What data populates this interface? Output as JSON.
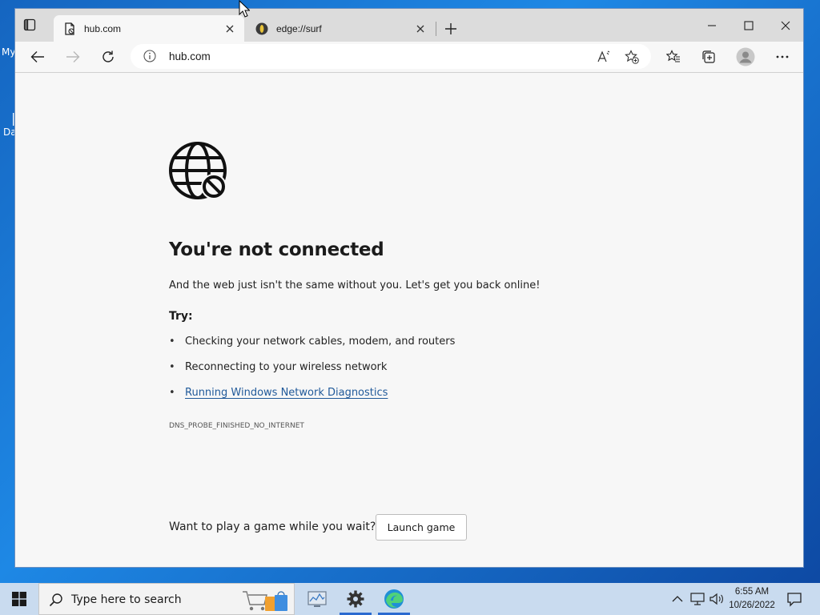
{
  "desktop": {
    "label_1": "My",
    "label_2": "Da"
  },
  "browser": {
    "tabs": [
      {
        "title": "hub.com",
        "favicon": "document-icon",
        "active": true
      },
      {
        "title": "edge://surf",
        "favicon": "surf-icon",
        "active": false
      }
    ],
    "address": "hub.com"
  },
  "error_page": {
    "icon": "globe-blocked-icon",
    "headline": "You're not connected",
    "subtitle": "And the web just isn't the same without you. Let's get you back online!",
    "try_label": "Try:",
    "suggestions": [
      "Checking your network cables, modem, and routers",
      "Reconnecting to your wireless network",
      "Running Windows Network Diagnostics"
    ],
    "error_code": "DNS_PROBE_FINISHED_NO_INTERNET",
    "game_prompt": "Want to play a game while you wait?",
    "game_button": "Launch game"
  },
  "taskbar": {
    "search_placeholder": "Type here to search",
    "time": "6:55 AM",
    "date": "10/26/2022"
  },
  "colors": {
    "link": "#215a9a",
    "taskbar": "#c9dbef",
    "accent": "#2a6ad0"
  }
}
